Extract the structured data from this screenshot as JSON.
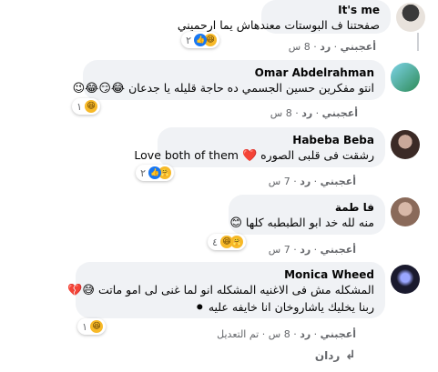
{
  "actions": {
    "like": "أعجبني",
    "reply": "رد",
    "sep": "·",
    "edited": "تم التعديل"
  },
  "comments": [
    {
      "author": "It's me",
      "text": "صفحتنا ف البوستات معندهاش يما ارحميني",
      "time": "8 س",
      "reaction_count": "٢",
      "reactions": [
        "like",
        "haha"
      ]
    },
    {
      "author": "Omar Abdelrahman",
      "text": "انتو مفكرين حسين الجسمي ده حاجة قليله يا جدعان",
      "emoji": "😂😏😂😉",
      "time": "8 س",
      "reaction_count": "١",
      "reactions": [
        "haha"
      ]
    },
    {
      "author": "Habeba Beba",
      "text": "رشقت فى قلبى الصوره",
      "text_latin": "Love both of them",
      "emoji": "❤️",
      "time": "7 س",
      "reaction_count": "٢",
      "reactions": [
        "like",
        "care"
      ]
    },
    {
      "author": "فا طمة",
      "text": "منه لله خد ابو الطبطبه كلها",
      "emoji": "😊",
      "time": "7 س",
      "reaction_count": "٤",
      "reactions": [
        "haha",
        "care"
      ]
    },
    {
      "author": "Monica Wheed",
      "text_line1": "المشكله مش فى الاغنيه المشكله انو لما غنى لى امو ماتت",
      "text_line2": "ربنا يخليك ياشاروخان انا خايفه عليه",
      "emoji1": "😅💔",
      "emoji2": "⚫",
      "time": "8 س",
      "reaction_count": "١",
      "reactions": [
        "haha"
      ]
    }
  ],
  "reply_link": "ردان",
  "colors": {
    "bubble": "#f0f2f5",
    "meta": "#65676b",
    "like_blue": "#1877f2",
    "haha_yellow": "#f7b928"
  },
  "icons": {
    "reply_arrow": "reply-arrow-icon"
  }
}
